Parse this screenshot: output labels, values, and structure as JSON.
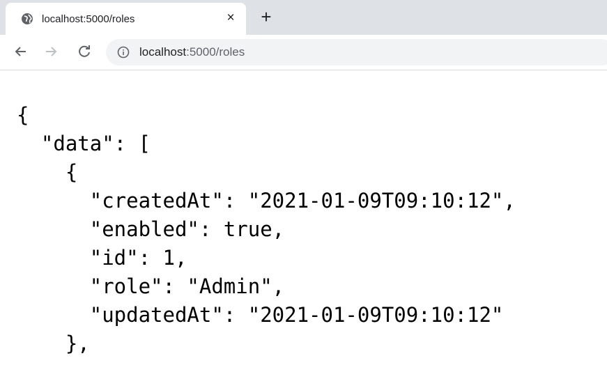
{
  "tab": {
    "title": "localhost:5000/roles",
    "close_symbol": "×",
    "new_tab_symbol": "+",
    "favicon": "globe-icon"
  },
  "toolbar": {
    "back_icon": "arrow-left-icon",
    "forward_icon": "arrow-right-icon",
    "reload_icon": "reload-icon",
    "url_host": "localhost",
    "url_path": ":5000/roles",
    "info_icon": "info-icon"
  },
  "content": {
    "lines": [
      "{",
      "  \"data\": [",
      "    {",
      "      \"createdAt\": \"2021-01-09T09:10:12\",",
      "      \"enabled\": true,",
      "      \"id\": 1,",
      "      \"role\": \"Admin\",",
      "      \"updatedAt\": \"2021-01-09T09:10:12\"",
      "    },"
    ]
  },
  "colors": {
    "tabstrip": "#dee1e6",
    "omnibox": "#f1f3f4",
    "text": "#202124",
    "muted": "#5f6368"
  }
}
